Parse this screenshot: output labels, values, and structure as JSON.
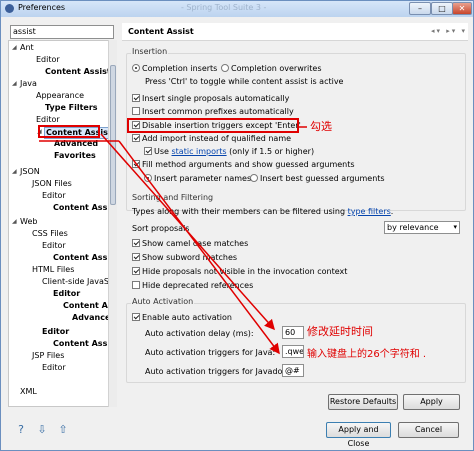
{
  "window": {
    "title": "Preferences",
    "ghost_title": "- Spring Tool Suite 3 -",
    "min_label": "–",
    "max_label": "□",
    "close_label": "✕"
  },
  "filter": {
    "value": "assist"
  },
  "tree": {
    "ant": "Ant",
    "ant_editor": "Editor",
    "ant_ca": "Content Assist",
    "java": "Java",
    "appearance": "Appearance",
    "type_filters": "Type Filters",
    "java_editor": "Editor",
    "java_ca": "Content Assist",
    "advanced": "Advanced",
    "favorites": "Favorites",
    "json": "JSON",
    "json_files": "JSON Files",
    "json_editor": "Editor",
    "json_ca": "Content Assis",
    "web": "Web",
    "css_files": "CSS Files",
    "css_editor": "Editor",
    "css_ca": "Content Assis",
    "html_files": "HTML Files",
    "client_js": "Client-side JavaS",
    "cjs_editor": "Editor",
    "cjs_ca": "Content Assis",
    "cjs_adv": "Advanced",
    "html_editor": "Editor",
    "html_ca": "Content Assis",
    "jsp_files": "JSP Files",
    "jsp_editor": "Editor",
    "xml": "XML"
  },
  "page": {
    "title": "Content Assist"
  },
  "insertion": {
    "label": "Insertion",
    "completion_inserts": "Completion inserts",
    "completion_overwrites": "Completion overwrites",
    "toggle_hint": "Press 'Ctrl' to toggle while content assist is active",
    "insert_single": "Insert single proposals automatically",
    "insert_common": "Insert common prefixes automatically",
    "disable_triggers": "Disable insertion triggers except 'Enter'",
    "add_import": "Add import instead of qualified name",
    "use_label": "Use",
    "static_imports": "static imports",
    "only_if": "(only if 1.5 or higher)",
    "fill_args": "Fill method arguments and show guessed arguments",
    "insert_param_names": "Insert parameter names",
    "insert_best_guessed": "Insert best guessed arguments"
  },
  "sorting": {
    "label": "Sorting and Filtering",
    "types_text": "Types along with their members can be filtered using",
    "type_filters_link": "type filters",
    "sort_proposals": "Sort proposals",
    "sort_value": "by relevance",
    "show_camel": "Show camel case matches",
    "show_subword": "Show subword matches",
    "hide_not_visible": "Hide proposals not visible in the invocation context",
    "hide_deprecated": "Hide deprecated references"
  },
  "auto": {
    "label": "Auto Activation",
    "enable": "Enable auto activation",
    "delay_label": "Auto activation delay (ms):",
    "delay_value": "60",
    "java_label": "Auto activation triggers for Java:",
    "java_value": ".qwer",
    "javadoc_label": "Auto activation triggers for Javadoc:",
    "javadoc_value": "@#"
  },
  "buttons": {
    "restore": "Restore Defaults",
    "apply": "Apply",
    "apply_close": "Apply and Close",
    "cancel": "Cancel"
  },
  "annotations": {
    "check": "勾选",
    "delay": "修改延时时间",
    "keys": "输入键盘上的26个字符和 ."
  },
  "colors": {
    "annotation": "#e00000",
    "link": "#0645ad",
    "selection": "#d9e8fb"
  }
}
